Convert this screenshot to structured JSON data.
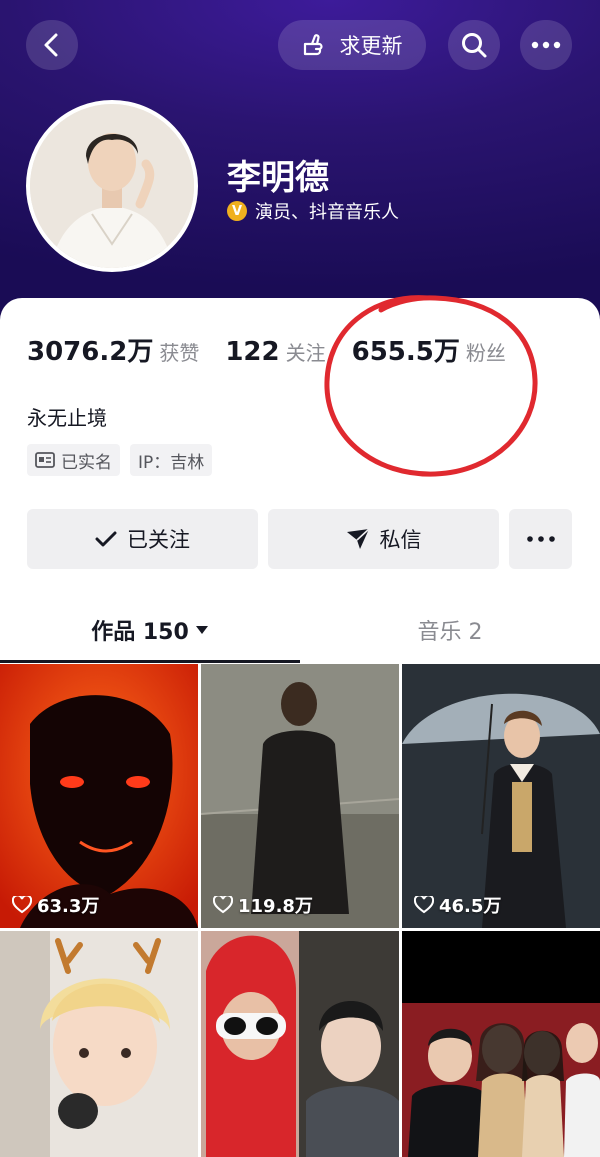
{
  "header": {
    "request_update_label": "求更新",
    "name": "李明德",
    "verify_badge": "V",
    "verify_text": "演员、抖音音乐人"
  },
  "stats": [
    {
      "value": "3076.2万",
      "label": "获赞"
    },
    {
      "value": "122",
      "label": "关注"
    },
    {
      "value": "655.5万",
      "label": "粉丝"
    }
  ],
  "bio": "永无止境",
  "tags": [
    {
      "icon": "id-card-icon",
      "label": "已实名"
    },
    {
      "label": "IP：吉林"
    }
  ],
  "actions": {
    "follow_label": "已关注",
    "message_label": "私信"
  },
  "tabs": [
    {
      "label": "作品 150",
      "active": true
    },
    {
      "label": "音乐 2",
      "active": false
    }
  ],
  "videos": [
    {
      "likes": "63.3万"
    },
    {
      "likes": "119.8万"
    },
    {
      "likes": "46.5万"
    },
    {
      "likes": ""
    },
    {
      "likes": ""
    },
    {
      "likes": ""
    }
  ],
  "colors": {
    "header_bg": "#2a1470",
    "annotation_circle": "#e0292f",
    "verify_gold": "#f0b01f"
  }
}
